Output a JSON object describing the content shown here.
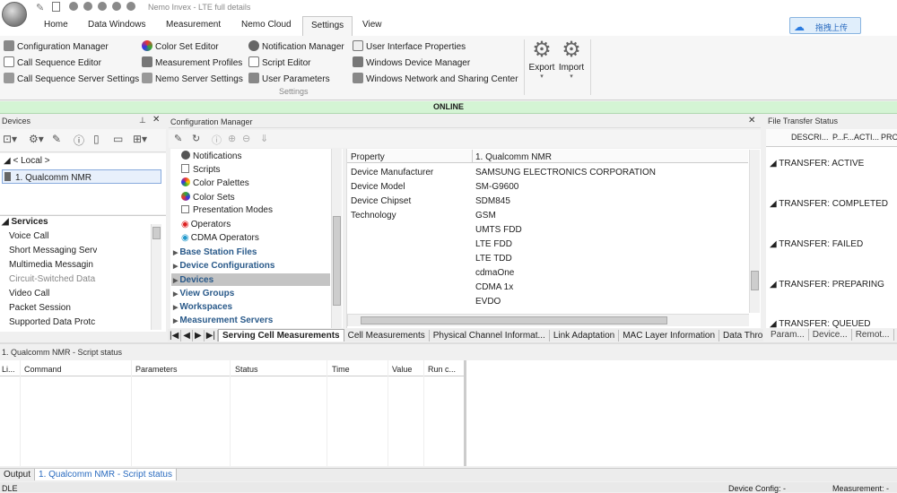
{
  "app": {
    "title": "Nemo Invex - LTE full details"
  },
  "tabs": [
    "Home",
    "Data Windows",
    "Measurement",
    "Nemo Cloud",
    "Settings",
    "View"
  ],
  "upload_label": "拖拽上传",
  "ribbon": {
    "col1": [
      "Configuration Manager",
      "Call Sequence Editor",
      "Call Sequence Server Settings"
    ],
    "col2": [
      "Color Set Editor",
      "Measurement Profiles",
      "Nemo Server Settings"
    ],
    "col3": [
      "Notification Manager",
      "Script Editor",
      "User Parameters"
    ],
    "col4": [
      "User Interface Properties",
      "Windows Device Manager",
      "Windows Network and Sharing Center"
    ],
    "export": "Export",
    "import": "Import",
    "group": "Settings"
  },
  "online": "ONLINE",
  "devices": {
    "title": "Devices",
    "local": "< Local >",
    "device": "1. Qualcomm NMR",
    "services_title": "Services",
    "services": [
      "Voice Call",
      "Short Messaging Serv",
      "Multimedia Messagin",
      "Circuit-Switched Data",
      "Video Call",
      "Packet Session",
      "Supported Data Protc"
    ]
  },
  "config": {
    "title": "Configuration Manager",
    "tree": [
      "Notifications",
      "Scripts",
      "Color Palettes",
      "Color Sets",
      "Presentation Modes",
      "Operators",
      "CDMA Operators"
    ],
    "nav": [
      "Base Station Files",
      "Device Configurations",
      "Devices",
      "View Groups",
      "Workspaces",
      "Measurement Servers"
    ],
    "prop_header": "Property",
    "val_header": "1. Qualcomm NMR",
    "props": [
      "Device Manufacturer",
      "Device Model",
      "Device Chipset",
      "Technology"
    ],
    "vals": [
      "SAMSUNG ELECTRONICS CORPORATION",
      "SM-G9600",
      "SDM845",
      "GSM",
      "UMTS FDD",
      "LTE FDD",
      "LTE TDD",
      "cdmaOne",
      "CDMA 1x",
      "EVDO"
    ]
  },
  "file_transfer": {
    "title": "File Transfer Status",
    "cols": [
      "DESCRI...",
      "P...",
      "F...",
      "ACTI...",
      "PRO"
    ],
    "groups": [
      "TRANSFER: ACTIVE",
      "TRANSFER: COMPLETED",
      "TRANSFER: FAILED",
      "TRANSFER: PREPARING",
      "TRANSFER: QUEUED"
    ],
    "bottom_tabs": [
      "Param...",
      "Device...",
      "Remot..."
    ]
  },
  "bottom_tabs": [
    "Serving Cell Measurements",
    "Cell Measurements",
    "Physical Channel Informat...",
    "Link Adaptation",
    "MAC Layer Information",
    "Data Thro"
  ],
  "script": {
    "title": "1. Qualcomm NMR - Script status",
    "cols": [
      "Li...",
      "Command",
      "Parameters",
      "Status",
      "Time",
      "Value",
      "Run c..."
    ]
  },
  "output_tabs": [
    "Output",
    "1. Qualcomm NMR - Script status"
  ],
  "status": {
    "left": "DLE",
    "device_config": "Device Config: -",
    "measurement": "Measurement: -"
  }
}
